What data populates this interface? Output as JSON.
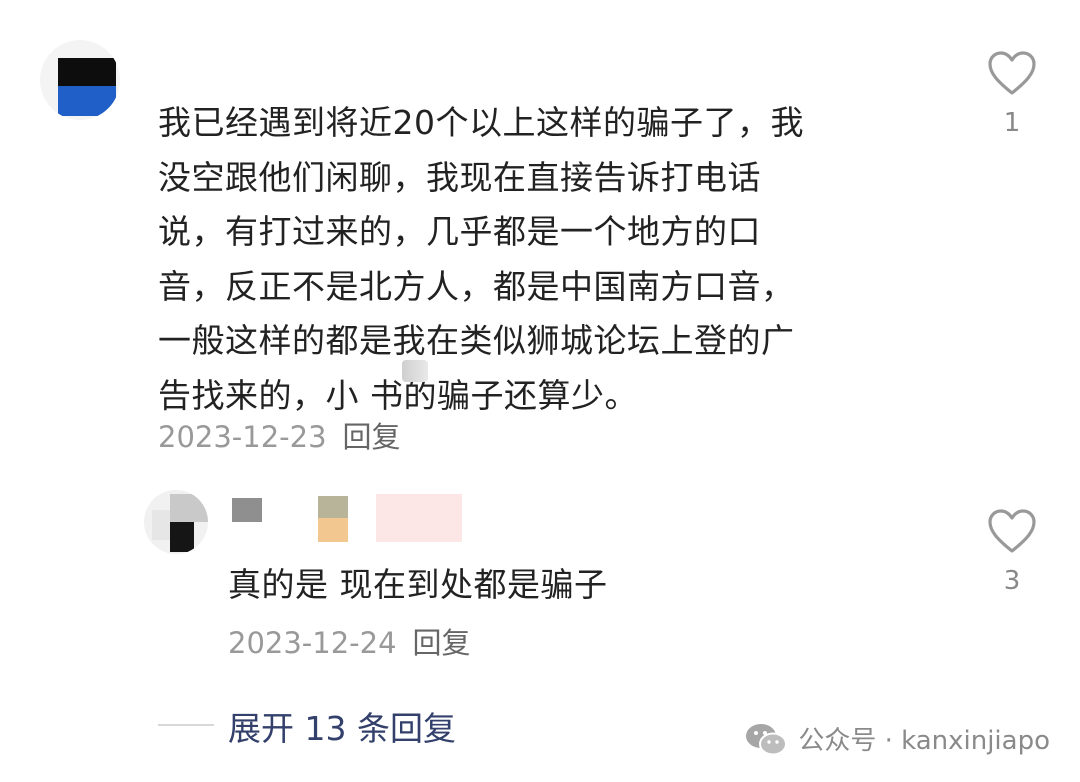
{
  "main_comment": {
    "text_lines": [
      "我已经遇到将近20个以上这样的骗子了，我",
      "没空跟他们闲聊，我现在直接告诉打电话",
      "说，有打过来的，几乎都是一个地方的口",
      "音，反正不是北方人，都是中国南方口音，",
      "一般这样的都是我在类似狮城论坛上登的广",
      "告找来的，小 书的骗子还算少。"
    ],
    "date": "2023-12-23",
    "reply_label": "回复",
    "like_count": "1",
    "avatar_colors": [
      "#0d0d0d",
      "#1f5fc7"
    ]
  },
  "reply_comment": {
    "text": "真的是 现在到处都是骗子",
    "date": "2023-12-24",
    "reply_label": "回复",
    "like_count": "3"
  },
  "expand": {
    "label": "展开 13 条回复"
  },
  "watermark": {
    "text": "公众号 · kanxinjiapo",
    "icon": "wechat-icon"
  },
  "colors": {
    "link": "#33406b",
    "meta": "#999999",
    "text": "#222222"
  }
}
